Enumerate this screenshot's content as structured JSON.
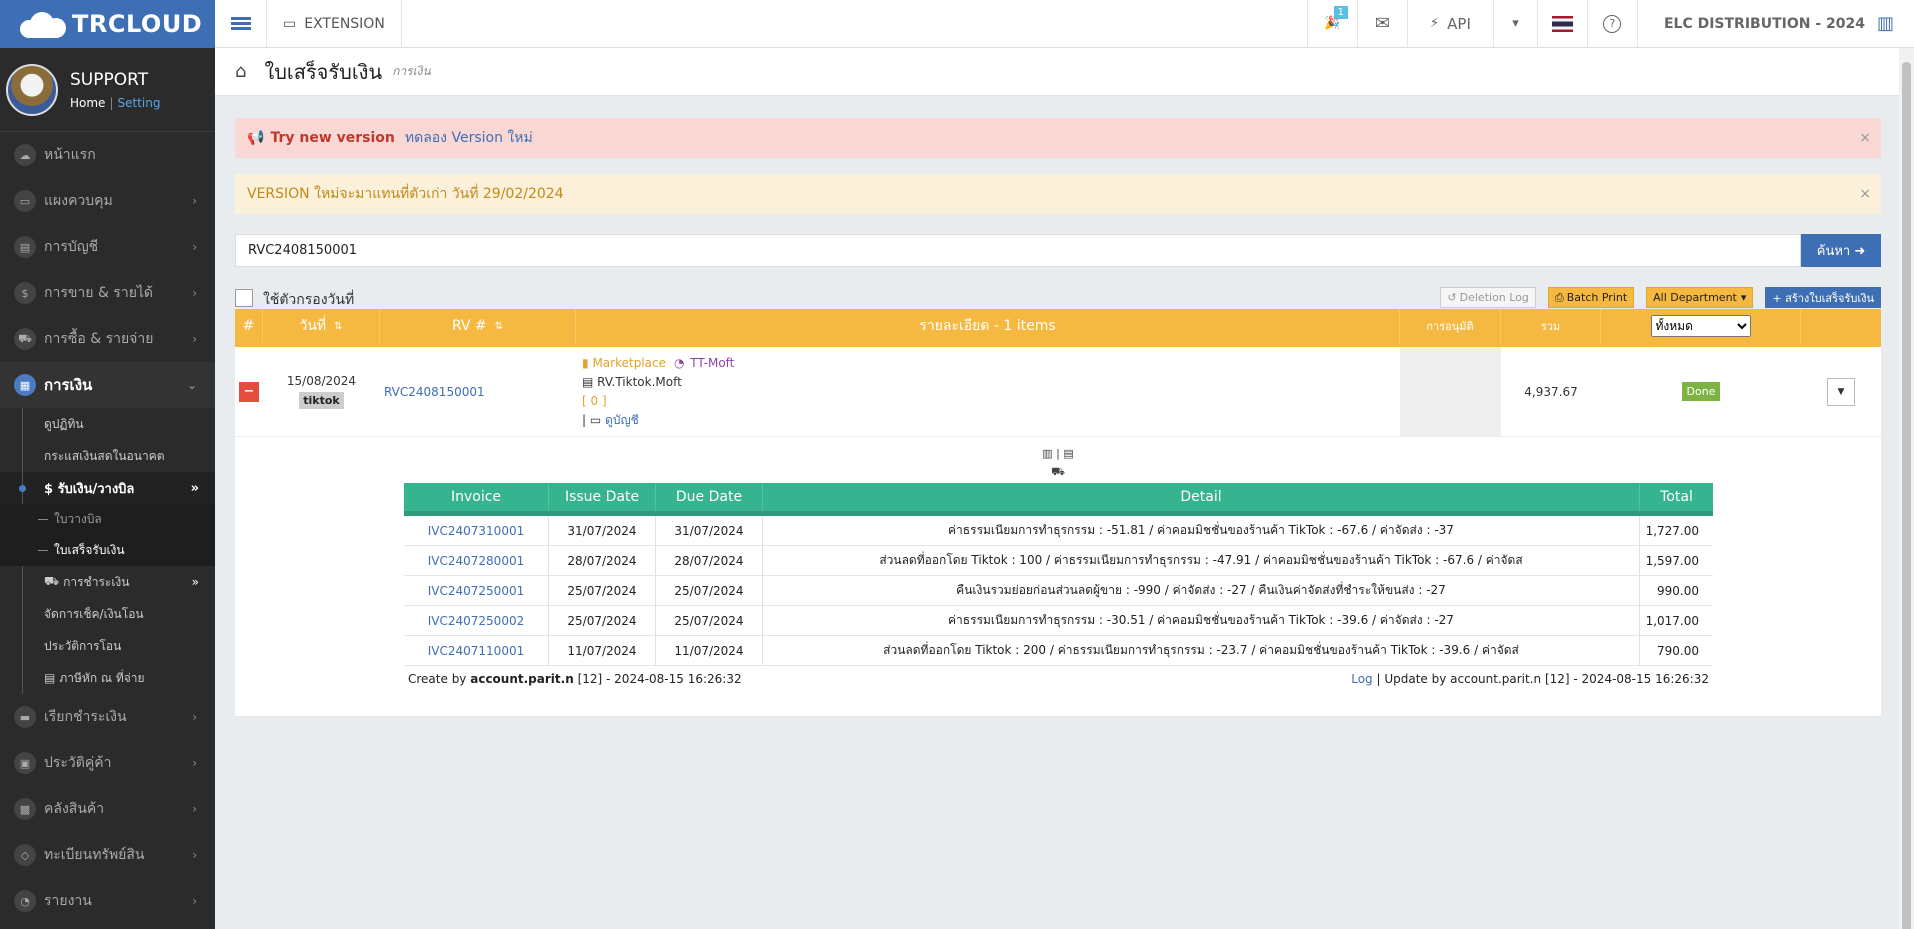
{
  "brand": {
    "name_bold": "TR",
    "name_rest": "CLOUD"
  },
  "profile": {
    "name": "SUPPORT",
    "home": "Home",
    "sep": "|",
    "setting": "Setting"
  },
  "sidebar": {
    "items": [
      {
        "label": "หน้าแรก",
        "icon": "cloud-icon"
      },
      {
        "label": "แผงควบคุม",
        "icon": "monitor-icon"
      },
      {
        "label": "การบัญชี",
        "icon": "book-icon"
      },
      {
        "label": "การขาย & รายได้",
        "icon": "dollar-icon"
      },
      {
        "label": "การซื้อ & รายจ่าย",
        "icon": "cart-icon"
      },
      {
        "label": "การเงิน",
        "icon": "calendar-icon"
      }
    ],
    "sub": [
      {
        "label": "ดูปฏิทิน"
      },
      {
        "label": "กระแสเงินสดในอนาคต"
      },
      {
        "label": "$ รับเงิน/วางบิล"
      },
      {
        "label": "ใบวางบิล"
      },
      {
        "label": "ใบเสร็จรับเงิน"
      },
      {
        "label": "การชำระเงิน"
      },
      {
        "label": "จัดการเช็ค/เงินโอน"
      },
      {
        "label": "ประวัติการโอน"
      },
      {
        "label": "ภาษีหัก ณ ที่จ่าย"
      }
    ],
    "items2": [
      {
        "label": "เรียกชำระเงิน",
        "icon": "card-icon"
      },
      {
        "label": "ประวัติคู่ค้า",
        "icon": "contact-icon"
      },
      {
        "label": "คลังสินค้า",
        "icon": "boxes-icon"
      },
      {
        "label": "ทะเบียนทรัพย์สิน",
        "icon": "diamond-icon"
      },
      {
        "label": "รายงาน",
        "icon": "report-icon"
      }
    ]
  },
  "topbar": {
    "extension": "EXTENSION",
    "badge": "1",
    "api": "API",
    "company": "ELC DISTRIBUTION - 2024"
  },
  "page": {
    "title": "ใบเสร็จรับเงิน",
    "subtitle": "การเงิน"
  },
  "alerts": {
    "new_version_bold": "Try new version",
    "new_version_link": "ทดลอง Version ใหม่",
    "notice": "VERSION ใหม่จะมาแทนที่ตัวเก่า วันที่ 29/02/2024",
    "close": "×"
  },
  "search": {
    "value": "RVC2408150001",
    "button": "ค้นหา"
  },
  "toolbar": {
    "date_filter": "ใช้ตัวกรองวันที่",
    "deletion_log": "Deletion Log",
    "batch_print": "Batch Print",
    "department": "All Department",
    "create": "+ สร้างใบเสร็จรับเงิน"
  },
  "table": {
    "headers": {
      "num": "#",
      "date": "วันที่",
      "rv": "RV #",
      "detail": "รายละเอียด - 1 items",
      "approve": "การอนุมัติ",
      "total": "รวม",
      "filter": "ทั้งหมด"
    },
    "row": {
      "date": "15/08/2024",
      "tag": "tiktok",
      "rv": "RVC2408150001",
      "marketplace": "Marketplace",
      "shop": "TT-Moft",
      "name": "RV.Tiktok.Moft",
      "count": "[ 0 ]",
      "view": "ดูบัญชี",
      "total": "4,937.67",
      "status": "Done"
    }
  },
  "invoices": {
    "headers": [
      "Invoice",
      "Issue Date",
      "Due Date",
      "Detail",
      "Total"
    ],
    "rows": [
      {
        "invoice": "IVC2407310001",
        "issue": "31/07/2024",
        "due": "31/07/2024",
        "detail": "ค่าธรรมเนียมการทำธุรกรรม : -51.81 / ค่าคอมมิชชั่นของร้านค้า TikTok : -67.6 / ค่าจัดส่ง : -37",
        "total": "1,727.00"
      },
      {
        "invoice": "IVC2407280001",
        "issue": "28/07/2024",
        "due": "28/07/2024",
        "detail": "ส่วนลดที่ออกโดย Tiktok : 100 / ค่าธรรมเนียมการทำธุรกรรม : -47.91 / ค่าคอมมิชชั่นของร้านค้า TikTok : -67.6 / ค่าจัดส",
        "total": "1,597.00"
      },
      {
        "invoice": "IVC2407250001",
        "issue": "25/07/2024",
        "due": "25/07/2024",
        "detail": "คืนเงินรวมย่อยก่อนส่วนลดผู้ขาย : -990 / ค่าจัดส่ง : -27 / คืนเงินค่าจัดส่งที่ชำระให้ขนส่ง : -27",
        "total": "990.00"
      },
      {
        "invoice": "IVC2407250002",
        "issue": "25/07/2024",
        "due": "25/07/2024",
        "detail": "ค่าธรรมเนียมการทำธุรกรรม : -30.51 / ค่าคอมมิชชั่นของร้านค้า TikTok : -39.6 / ค่าจัดส่ง : -27",
        "total": "1,017.00"
      },
      {
        "invoice": "IVC2407110001",
        "issue": "11/07/2024",
        "due": "11/07/2024",
        "detail": "ส่วนลดที่ออกโดย Tiktok : 200 / ค่าธรรมเนียมการทำธุรกรรม : -23.7 / ค่าคอมมิชชั่นของร้านค้า TikTok : -39.6 / ค่าจัดส่",
        "total": "790.00"
      }
    ],
    "footer": {
      "create_prefix": "Create by",
      "create_user": "account.parit.n",
      "create_suffix": "[12] - 2024-08-15 16:26:32",
      "log": "Log",
      "update": "| Update by account.parit.n [12] - 2024-08-15 16:26:32"
    }
  }
}
